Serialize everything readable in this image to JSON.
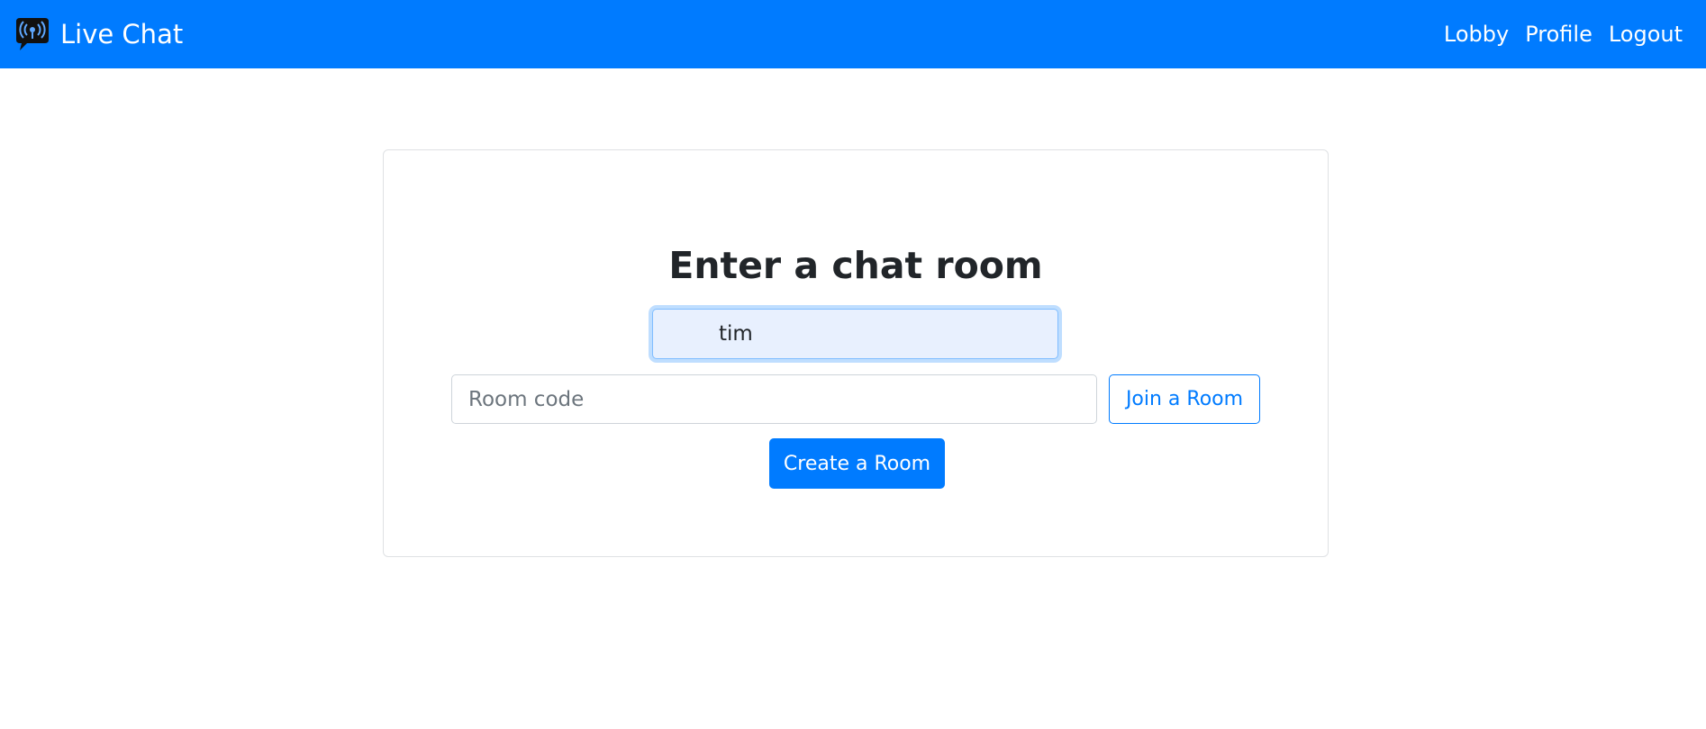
{
  "navbar": {
    "brand_icon": "chat-bubble-broadcast-icon",
    "brand_label": "Live Chat",
    "links": [
      {
        "label": "Lobby"
      },
      {
        "label": "Profile"
      },
      {
        "label": "Logout"
      }
    ],
    "color": "#007bff"
  },
  "main": {
    "heading": "Enter a chat room",
    "name_input": {
      "value": "tim",
      "focused": true
    },
    "room_code": {
      "placeholder": "Room code",
      "value": ""
    },
    "join_button": "Join a Room",
    "create_button": "Create a Room"
  }
}
